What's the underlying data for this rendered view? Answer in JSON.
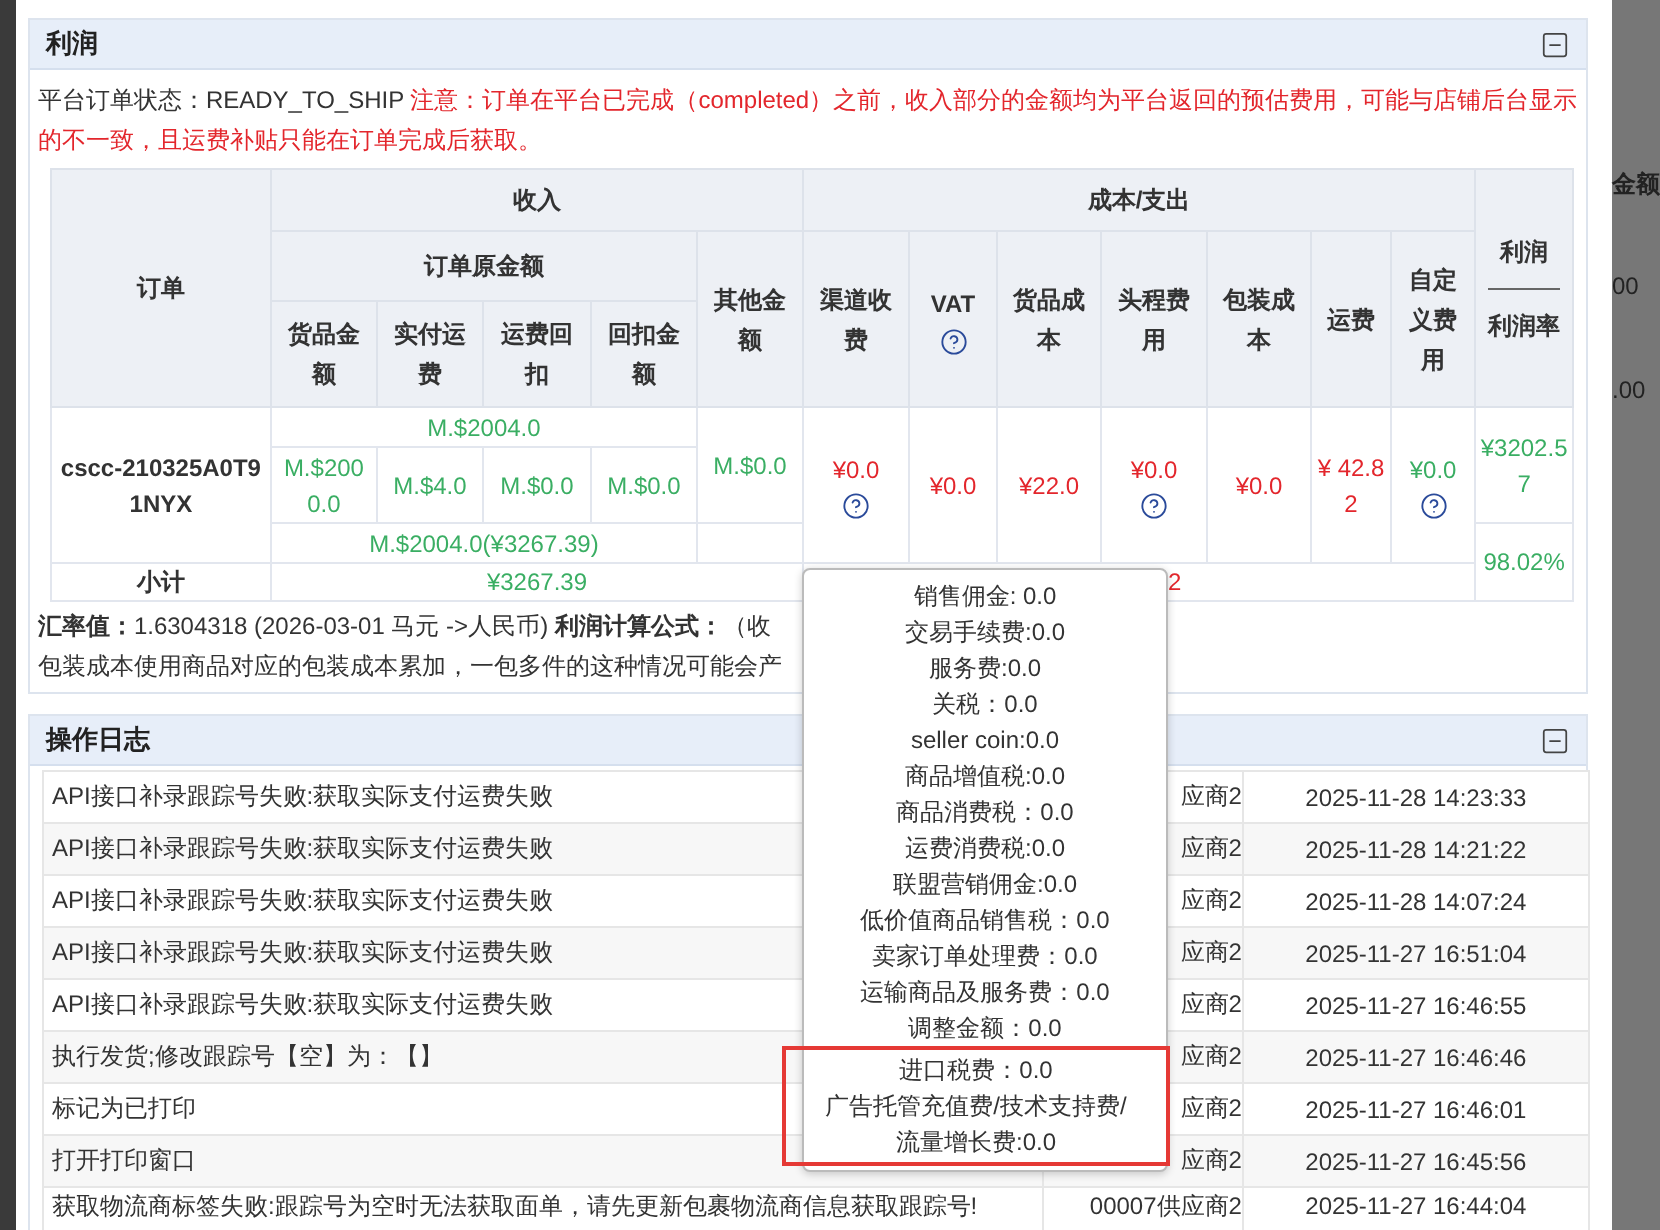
{
  "profit_section": {
    "title": "利润",
    "status": "平台订单状态：READY_TO_SHIP",
    "warning": "注意：订单在平台已完成（completed）之前，收入部分的金额均为平台返回的预估费用，可能与店铺后台显示的不一致，且运费补贴只能在订单完成后获取。",
    "table": {
      "order_header": "订单",
      "income_header": "收入",
      "original_header": "订单原金额",
      "income_columns": [
        "货品金额",
        "实付运费",
        "运费回扣",
        "回扣金额"
      ],
      "other_header": "其他金额",
      "cost_header": "成本/支出",
      "cost_columns": [
        {
          "label": "渠道收费",
          "help": false
        },
        {
          "label": "VAT",
          "help": true
        },
        {
          "label": "货品成本",
          "help": false
        },
        {
          "label": "头程费用",
          "help": false
        },
        {
          "label": "包装成本",
          "help": false
        },
        {
          "label": "运费",
          "help": false
        },
        {
          "label": "自定义费用",
          "help": false
        }
      ],
      "profit_header": "利润",
      "rate_header": "利润率",
      "row": {
        "order": "cscc-210325A0T91NYX",
        "original_total": "M.$2004.0",
        "income_values": [
          "M.$2000.0",
          "M.$4.0",
          "M.$0.0",
          "M.$0.0"
        ],
        "converted": "M.$2004.0(¥3267.39)",
        "other": "M.$0.0",
        "costs": [
          {
            "text": "¥0.0",
            "color": "#e3262c",
            "help": true
          },
          {
            "text": "¥0.0",
            "color": "#e3262c",
            "help": false
          },
          {
            "text": "¥22.0",
            "color": "#e3262c",
            "help": false
          },
          {
            "text": "¥0.0",
            "color": "#e3262c",
            "help": true
          },
          {
            "text": "¥0.0",
            "color": "#e3262c",
            "help": false
          },
          {
            "text": "¥ 42.82",
            "color": "#e3262c",
            "help": false
          },
          {
            "text": "¥0.0",
            "color": "#3aae63",
            "help": true
          }
        ],
        "profit": "¥3202.57",
        "rate": "98.02%"
      },
      "subtotal": {
        "label": "小计",
        "income": "¥3267.39",
        "cost": "2"
      }
    },
    "exchange_label": "汇率值：",
    "exchange_value": "1.6304318 (2026-03-01 马元 ->人民币)",
    "formula_label": "利润计算公式：",
    "formula_value": "（收",
    "note": "包装成本使用商品对应的包装成本累加，一包多件的这种情况可能会产"
  },
  "log_section": {
    "title": "操作日志",
    "rows": [
      {
        "text": "API接口补录跟踪号失败:获取实际支付运费失败",
        "operator": "应商2",
        "time": "2025-11-28 14:23:33"
      },
      {
        "text": "API接口补录跟踪号失败:获取实际支付运费失败",
        "operator": "应商2",
        "time": "2025-11-28 14:21:22"
      },
      {
        "text": "API接口补录跟踪号失败:获取实际支付运费失败",
        "operator": "应商2",
        "time": "2025-11-28 14:07:24"
      },
      {
        "text": "API接口补录跟踪号失败:获取实际支付运费失败",
        "operator": "应商2",
        "time": "2025-11-27 16:51:04"
      },
      {
        "text": "API接口补录跟踪号失败:获取实际支付运费失败",
        "operator": "应商2",
        "time": "2025-11-27 16:46:55"
      },
      {
        "text": "执行发货;修改跟踪号【空】为：【】",
        "operator": "应商2",
        "time": "2025-11-27 16:46:46"
      },
      {
        "text": "标记为已打印",
        "operator": "应商2",
        "time": "2025-11-27 16:46:01"
      },
      {
        "text": "打开打印窗口",
        "operator": "应商2",
        "time": "2025-11-27 16:45:56"
      },
      {
        "text": "获取物流商标签失败:跟踪号为空时无法获取面单，请先更新包裹物流商信息获取跟踪号!",
        "operator": "00007供应商2",
        "time": "2025-11-27 16:44:04"
      }
    ]
  },
  "fee_popover": {
    "items": [
      {
        "text": "销售佣金: 0.0",
        "highlighted": false
      },
      {
        "text": "交易手续费:0.0",
        "highlighted": false
      },
      {
        "text": "服务费:0.0",
        "highlighted": false
      },
      {
        "text": "关税：0.0",
        "highlighted": false
      },
      {
        "text": "seller coin:0.0",
        "highlighted": false
      },
      {
        "text": "商品增值税:0.0",
        "highlighted": false
      },
      {
        "text": "商品消费税：0.0",
        "highlighted": false
      },
      {
        "text": "运费消费税:0.0",
        "highlighted": false
      },
      {
        "text": "联盟营销佣金:0.0",
        "highlighted": false
      },
      {
        "text": "低价值商品销售税：0.0",
        "highlighted": false
      },
      {
        "text": "卖家订单处理费：0.0",
        "highlighted": false
      },
      {
        "text": "运输商品及服务费：0.0",
        "highlighted": false
      },
      {
        "text": "调整金额：0.0",
        "highlighted": false
      },
      {
        "text": "进口税费：0.0",
        "highlighted": true
      },
      {
        "text": "广告托管充值费/技术支持费/流量增长费:0.0",
        "highlighted": true
      }
    ]
  },
  "backdrop": {
    "texts": [
      "金额",
      "00",
      ".00"
    ]
  }
}
